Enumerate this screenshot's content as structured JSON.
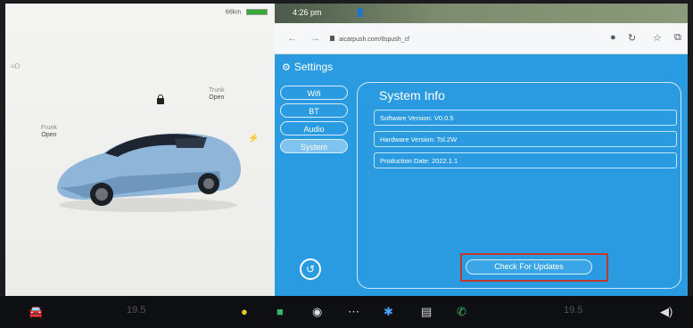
{
  "vehicle": {
    "status_text": "66km",
    "trunk_label": "Trunk",
    "trunk_state": "Open",
    "frunk_label": "Frunk",
    "frunk_state": "Open"
  },
  "browser": {
    "time": "4:26 pm",
    "url": "aicarpush.com/tlspush_cf"
  },
  "settings": {
    "title": "Settings",
    "tabs": [
      {
        "label": "Wifi"
      },
      {
        "label": "BT"
      },
      {
        "label": "Audio"
      },
      {
        "label": "System"
      }
    ],
    "active_tab": "System",
    "system_info": {
      "heading": "System Info",
      "software_version": "Software Version: V0.0.5",
      "hardware_version": "Hardware Version: Tsl.2W",
      "production_date": "Production Date: 2022.1.1"
    },
    "check_updates_label": "Check For Updates"
  },
  "dock": {
    "left_temp": "19.5",
    "right_temp": "19.5"
  },
  "colors": {
    "panel_blue": "#2a9be0",
    "highlight_red": "#c0392b",
    "car_body": "#8fb6d8"
  }
}
